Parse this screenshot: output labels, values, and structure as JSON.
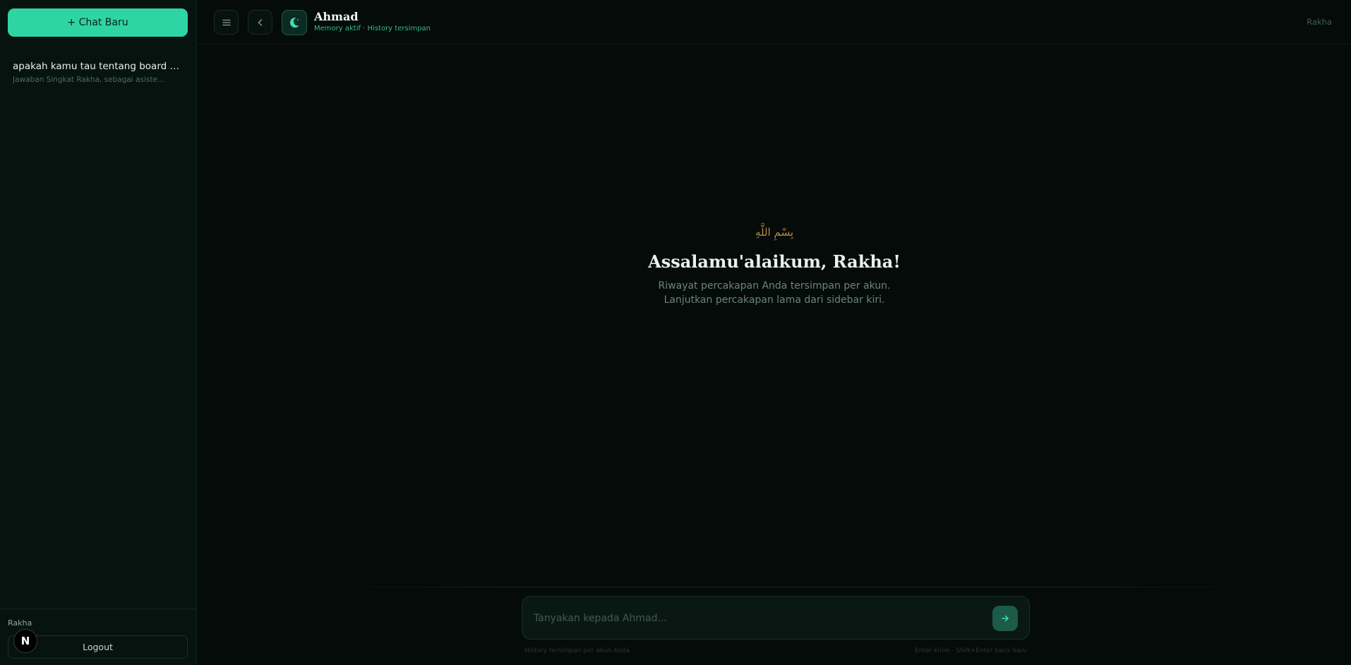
{
  "sidebar": {
    "new_chat_label": "+ Chat Baru",
    "chats": [
      {
        "title": "apakah kamu tau tentang board of...",
        "preview": "Jawaban Singkat Rakha, sebagai asisten..."
      }
    ],
    "footer": {
      "username": "Rakha",
      "logout_label": "Logout",
      "badge_letter": "N"
    }
  },
  "header": {
    "menu_icon": "menu-icon",
    "back_icon": "chevron-left-icon",
    "logo_icon": "crescent-moon-icon",
    "title": "Ahmad",
    "subtitle": "Memory aktif · History tersimpan",
    "user": "Rakha"
  },
  "welcome": {
    "bismillah": "بِسْمِ اللَّهِ",
    "title": "Assalamu'alaikum, Rakha!",
    "description": "Riwayat percakapan Anda tersimpan per akun. Lanjutkan percakapan lama dari sidebar kiri."
  },
  "composer": {
    "placeholder": "Tanyakan kepada Ahmad...",
    "send_icon": "arrow-right-icon",
    "hint_left": "History tersimpan per akun Anda",
    "hint_right": "Enter kirim · Shift+Enter baris baru"
  },
  "colors": {
    "accent": "#2fd4a5",
    "background": "#050b09",
    "sidebar": "#07130f",
    "gold": "#b48a42"
  }
}
